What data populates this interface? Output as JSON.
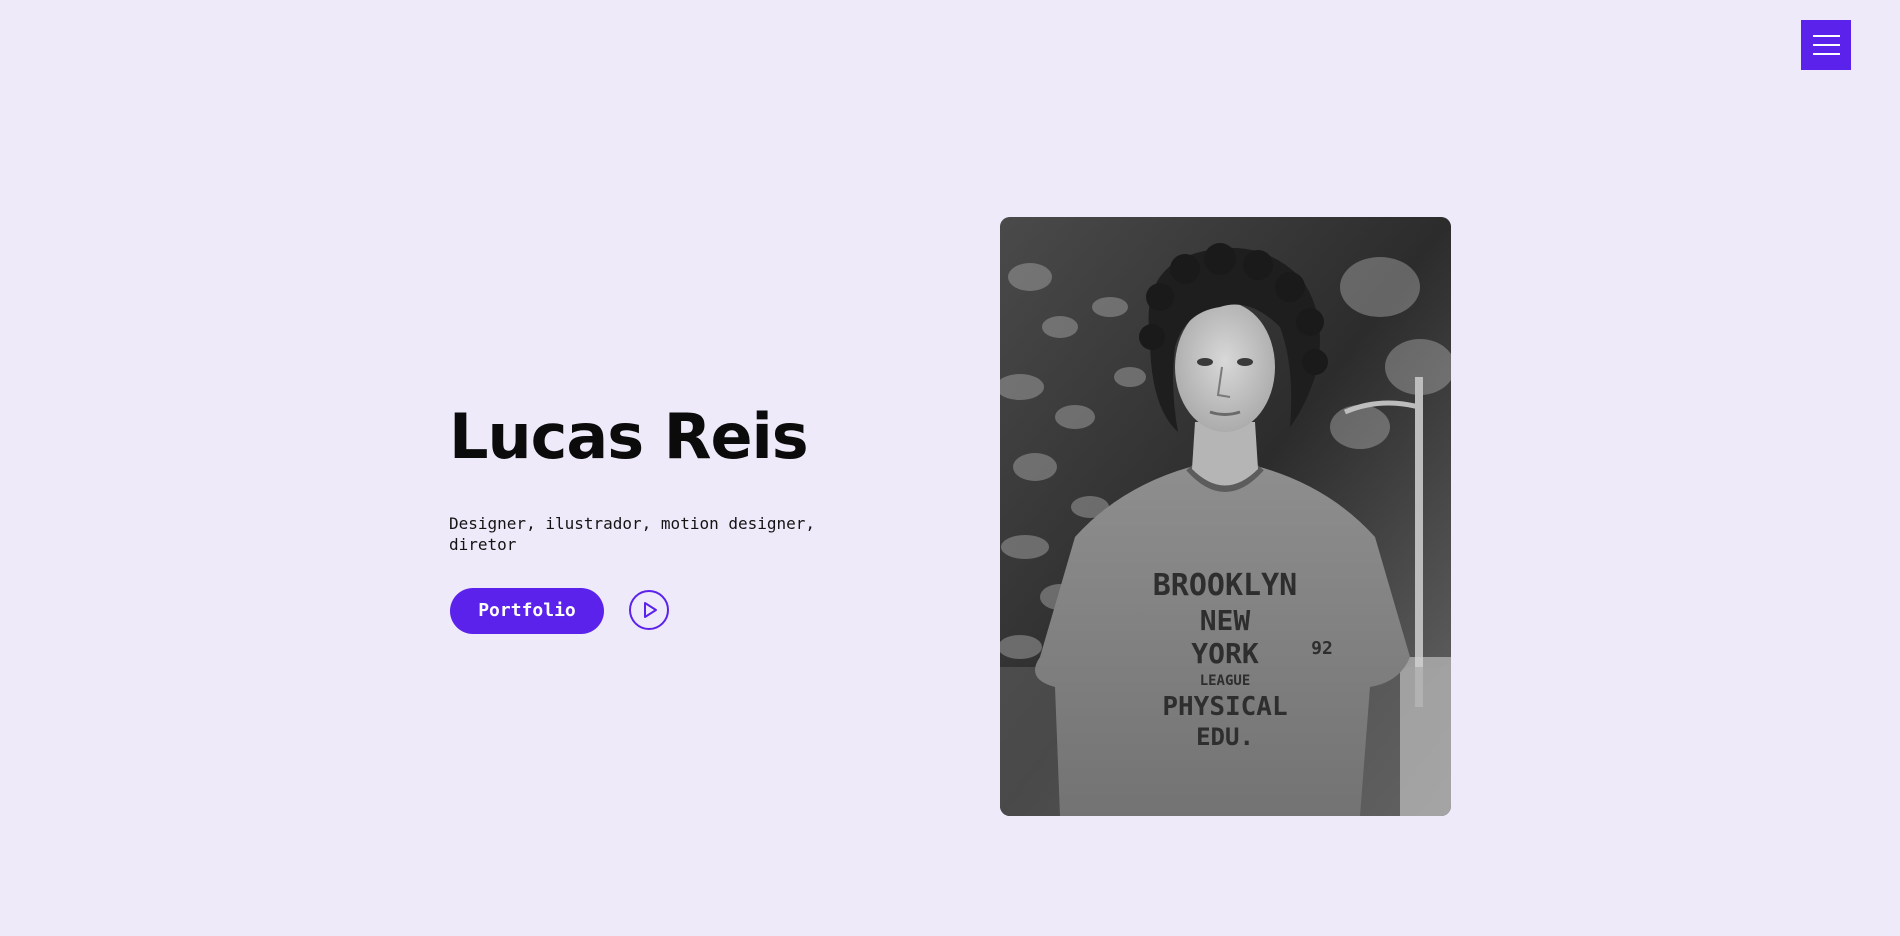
{
  "header": {
    "menu_icon": "hamburger-menu-icon"
  },
  "hero": {
    "name": "Lucas Reis",
    "tagline": "Designer, ilustrador, motion designer, diretor",
    "portfolio_label": "Portfolio",
    "play_icon": "play-circle-icon"
  },
  "portrait": {
    "shirt_line1": "BROOKLYN",
    "shirt_line2": "NEW",
    "shirt_line3": "YORK",
    "shirt_line4": "LEAGUE",
    "shirt_line5": "PHYSICAL",
    "shirt_line6": "EDU.",
    "shirt_number": "92"
  },
  "colors": {
    "background": "#eeeaf9",
    "accent": "#5b22eb",
    "text": "#0b0b0b"
  }
}
